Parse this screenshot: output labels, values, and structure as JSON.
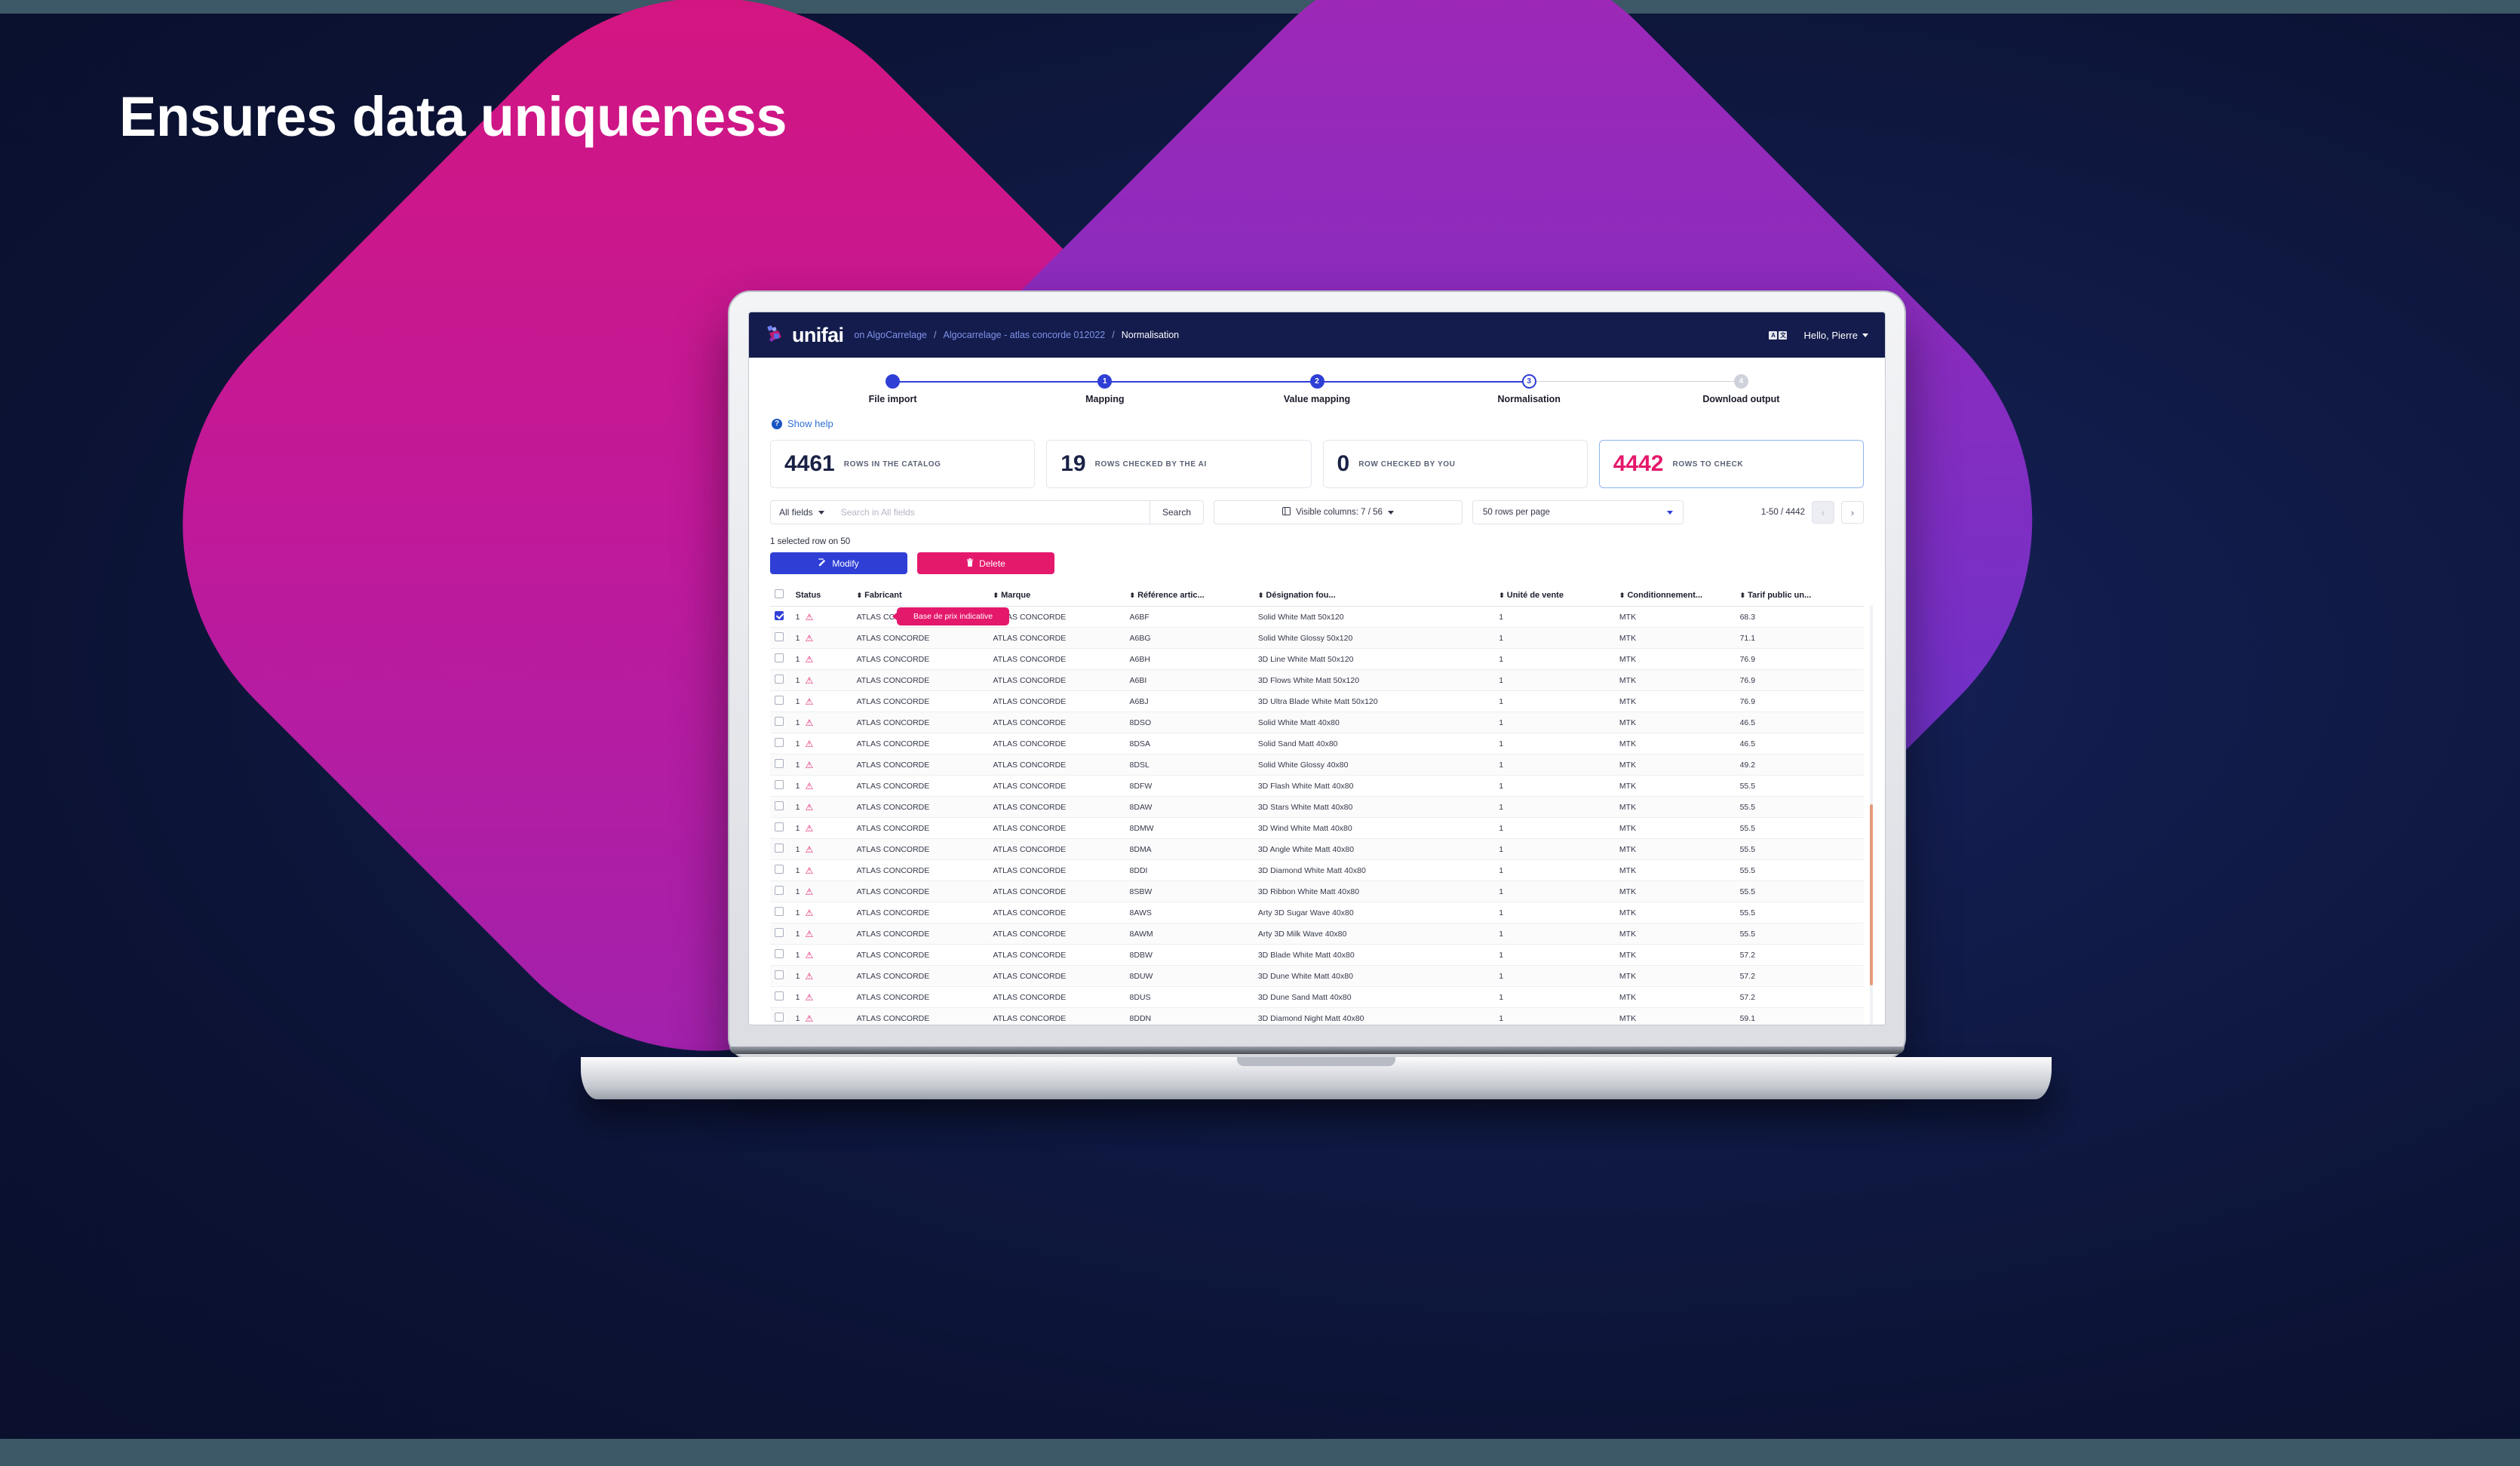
{
  "headline": "Ensures data uniqueness",
  "navbar": {
    "logo_text": "unifai",
    "breadcrumbs": [
      {
        "label": "on AlgoCarrelage",
        "type": "link"
      },
      {
        "label": "/",
        "type": "sep"
      },
      {
        "label": "Algocarrelage - atlas concorde 012022",
        "type": "link"
      },
      {
        "label": "/",
        "type": "sep"
      },
      {
        "label": "Normalisation",
        "type": "current"
      }
    ],
    "lang_a": "A",
    "lang_b": "文",
    "user_greeting": "Hello, Pierre"
  },
  "stepper": {
    "steps": [
      {
        "badge": "",
        "label": "File import",
        "state": "done"
      },
      {
        "badge": "1",
        "label": "Mapping",
        "state": "done"
      },
      {
        "badge": "2",
        "label": "Value mapping",
        "state": "done"
      },
      {
        "badge": "3",
        "label": "Normalisation",
        "state": "current"
      },
      {
        "badge": "4",
        "label": "Download output",
        "state": "todo"
      }
    ]
  },
  "help": {
    "label": "Show help",
    "icon": "?"
  },
  "cards": [
    {
      "value": "4461",
      "caption": "ROWS IN THE CATALOG",
      "accent": false
    },
    {
      "value": "19",
      "caption": "ROWS CHECKED BY THE AI",
      "accent": false
    },
    {
      "value": "0",
      "caption": "ROW CHECKED BY YOU",
      "accent": false
    },
    {
      "value": "4442",
      "caption": "ROWS TO CHECK",
      "accent": true
    }
  ],
  "toolbar": {
    "fields_label": "All fields",
    "search_placeholder": "Search in All fields",
    "search_value": "",
    "search_button": "Search",
    "visible_columns": "Visible columns: 7 / 56",
    "rows_per_page": "50 rows per page",
    "page_range": "1-50 / 4442",
    "prev_label": "‹",
    "next_label": "›"
  },
  "selection": {
    "info": "1 selected row on 50",
    "modify_label": "Modify",
    "delete_label": "Delete"
  },
  "tooltip": {
    "text": "Base de prix indicative"
  },
  "table": {
    "columns": [
      {
        "label": "",
        "sortable": false,
        "key": "checkbox"
      },
      {
        "label": "Status",
        "sortable": false,
        "key": "status"
      },
      {
        "label": "Fabricant",
        "sortable": true,
        "key": "fabricant"
      },
      {
        "label": "Marque",
        "sortable": true,
        "key": "marque"
      },
      {
        "label": "Référence artic...",
        "sortable": true,
        "key": "reference"
      },
      {
        "label": "Désignation fou...",
        "sortable": true,
        "key": "designation"
      },
      {
        "label": "Unité de vente",
        "sortable": true,
        "key": "unite"
      },
      {
        "label": "Conditionnement...",
        "sortable": true,
        "key": "conditionnement"
      },
      {
        "label": "Tarif public un...",
        "sortable": true,
        "key": "tarif"
      }
    ],
    "rows": [
      {
        "selected": true,
        "status_count": "1",
        "fabricant": "ATLAS CONCORDE",
        "marque": "ATLAS CONCORDE",
        "reference": "A6BF",
        "designation": "Solid White Matt 50x120",
        "unite": "1",
        "conditionnement": "MTK",
        "tarif": "68.3"
      },
      {
        "selected": false,
        "status_count": "1",
        "fabricant": "ATLAS CONCORDE",
        "marque": "ATLAS CONCORDE",
        "reference": "A6BG",
        "designation": "Solid White Glossy 50x120",
        "unite": "1",
        "conditionnement": "MTK",
        "tarif": "71.1"
      },
      {
        "selected": false,
        "status_count": "1",
        "fabricant": "ATLAS CONCORDE",
        "marque": "ATLAS CONCORDE",
        "reference": "A6BH",
        "designation": "3D Line White Matt 50x120",
        "unite": "1",
        "conditionnement": "MTK",
        "tarif": "76.9"
      },
      {
        "selected": false,
        "status_count": "1",
        "fabricant": "ATLAS CONCORDE",
        "marque": "ATLAS CONCORDE",
        "reference": "A6BI",
        "designation": "3D Flows White Matt 50x120",
        "unite": "1",
        "conditionnement": "MTK",
        "tarif": "76.9"
      },
      {
        "selected": false,
        "status_count": "1",
        "fabricant": "ATLAS CONCORDE",
        "marque": "ATLAS CONCORDE",
        "reference": "A6BJ",
        "designation": "3D Ultra Blade White Matt 50x120",
        "unite": "1",
        "conditionnement": "MTK",
        "tarif": "76.9"
      },
      {
        "selected": false,
        "status_count": "1",
        "fabricant": "ATLAS CONCORDE",
        "marque": "ATLAS CONCORDE",
        "reference": "8DSO",
        "designation": "Solid White Matt 40x80",
        "unite": "1",
        "conditionnement": "MTK",
        "tarif": "46.5"
      },
      {
        "selected": false,
        "status_count": "1",
        "fabricant": "ATLAS CONCORDE",
        "marque": "ATLAS CONCORDE",
        "reference": "8DSA",
        "designation": "Solid Sand Matt 40x80",
        "unite": "1",
        "conditionnement": "MTK",
        "tarif": "46.5"
      },
      {
        "selected": false,
        "status_count": "1",
        "fabricant": "ATLAS CONCORDE",
        "marque": "ATLAS CONCORDE",
        "reference": "8DSL",
        "designation": "Solid White Glossy 40x80",
        "unite": "1",
        "conditionnement": "MTK",
        "tarif": "49.2"
      },
      {
        "selected": false,
        "status_count": "1",
        "fabricant": "ATLAS CONCORDE",
        "marque": "ATLAS CONCORDE",
        "reference": "8DFW",
        "designation": "3D Flash White Matt 40x80",
        "unite": "1",
        "conditionnement": "MTK",
        "tarif": "55.5"
      },
      {
        "selected": false,
        "status_count": "1",
        "fabricant": "ATLAS CONCORDE",
        "marque": "ATLAS CONCORDE",
        "reference": "8DAW",
        "designation": "3D Stars White Matt 40x80",
        "unite": "1",
        "conditionnement": "MTK",
        "tarif": "55.5"
      },
      {
        "selected": false,
        "status_count": "1",
        "fabricant": "ATLAS CONCORDE",
        "marque": "ATLAS CONCORDE",
        "reference": "8DMW",
        "designation": "3D Wind White Matt 40x80",
        "unite": "1",
        "conditionnement": "MTK",
        "tarif": "55.5"
      },
      {
        "selected": false,
        "status_count": "1",
        "fabricant": "ATLAS CONCORDE",
        "marque": "ATLAS CONCORDE",
        "reference": "8DMA",
        "designation": "3D Angle White Matt 40x80",
        "unite": "1",
        "conditionnement": "MTK",
        "tarif": "55.5"
      },
      {
        "selected": false,
        "status_count": "1",
        "fabricant": "ATLAS CONCORDE",
        "marque": "ATLAS CONCORDE",
        "reference": "8DDI",
        "designation": "3D Diamond White Matt 40x80",
        "unite": "1",
        "conditionnement": "MTK",
        "tarif": "55.5"
      },
      {
        "selected": false,
        "status_count": "1",
        "fabricant": "ATLAS CONCORDE",
        "marque": "ATLAS CONCORDE",
        "reference": "8SBW",
        "designation": "3D Ribbon White Matt 40x80",
        "unite": "1",
        "conditionnement": "MTK",
        "tarif": "55.5"
      },
      {
        "selected": false,
        "status_count": "1",
        "fabricant": "ATLAS CONCORDE",
        "marque": "ATLAS CONCORDE",
        "reference": "8AWS",
        "designation": "Arty 3D Sugar Wave 40x80",
        "unite": "1",
        "conditionnement": "MTK",
        "tarif": "55.5"
      },
      {
        "selected": false,
        "status_count": "1",
        "fabricant": "ATLAS CONCORDE",
        "marque": "ATLAS CONCORDE",
        "reference": "8AWM",
        "designation": "Arty 3D Milk Wave 40x80",
        "unite": "1",
        "conditionnement": "MTK",
        "tarif": "55.5"
      },
      {
        "selected": false,
        "status_count": "1",
        "fabricant": "ATLAS CONCORDE",
        "marque": "ATLAS CONCORDE",
        "reference": "8DBW",
        "designation": "3D Blade White Matt 40x80",
        "unite": "1",
        "conditionnement": "MTK",
        "tarif": "57.2"
      },
      {
        "selected": false,
        "status_count": "1",
        "fabricant": "ATLAS CONCORDE",
        "marque": "ATLAS CONCORDE",
        "reference": "8DUW",
        "designation": "3D Dune White Matt 40x80",
        "unite": "1",
        "conditionnement": "MTK",
        "tarif": "57.2"
      },
      {
        "selected": false,
        "status_count": "1",
        "fabricant": "ATLAS CONCORDE",
        "marque": "ATLAS CONCORDE",
        "reference": "8DUS",
        "designation": "3D Dune Sand Matt 40x80",
        "unite": "1",
        "conditionnement": "MTK",
        "tarif": "57.2"
      },
      {
        "selected": false,
        "status_count": "1",
        "fabricant": "ATLAS CONCORDE",
        "marque": "ATLAS CONCORDE",
        "reference": "8DDN",
        "designation": "3D Diamond Night Matt 40x80",
        "unite": "1",
        "conditionnement": "MTK",
        "tarif": "59.1"
      }
    ]
  },
  "colors": {
    "brand_navy": "#141c4d",
    "accent_blue": "#2f3fd6",
    "accent_pink": "#e4196c",
    "bg_dark": "#0d1436"
  }
}
